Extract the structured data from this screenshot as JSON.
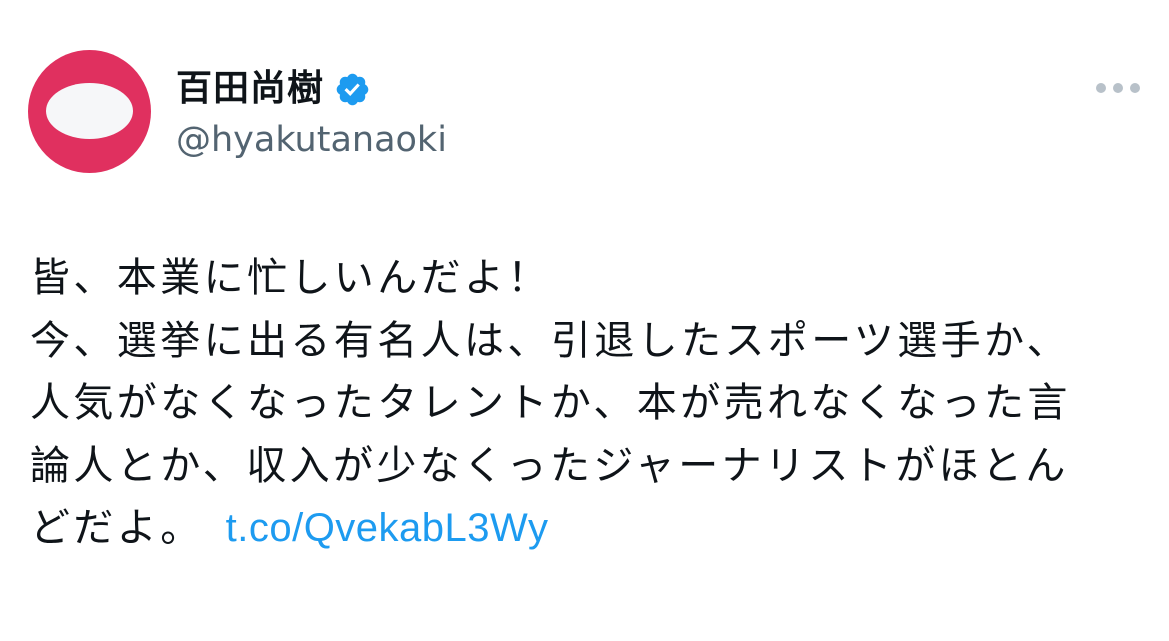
{
  "author": {
    "display_name": "百田尚樹",
    "handle": "@hyakutanaoki",
    "verified": true
  },
  "tweet": {
    "lines": [
      "皆、本業に忙しいんだよ！",
      "今、選挙に出る有名人は、引退したスポーツ選手か、",
      "人気がなくなったタレントか、本が売れなくなった言",
      "論人とか、収入が少なくったジャーナリストがほとん",
      "どだよ。"
    ],
    "link_text": "t.co/QvekabL3Wy"
  },
  "colors": {
    "avatar_background": "#e0305f",
    "verified_badge": "#1d9bf0",
    "link": "#1d9bf0",
    "handle_text": "#536471",
    "more_icon": "#b8c1c9"
  },
  "icons": {
    "verified": "verified-badge-icon",
    "more": "more-options-icon"
  }
}
